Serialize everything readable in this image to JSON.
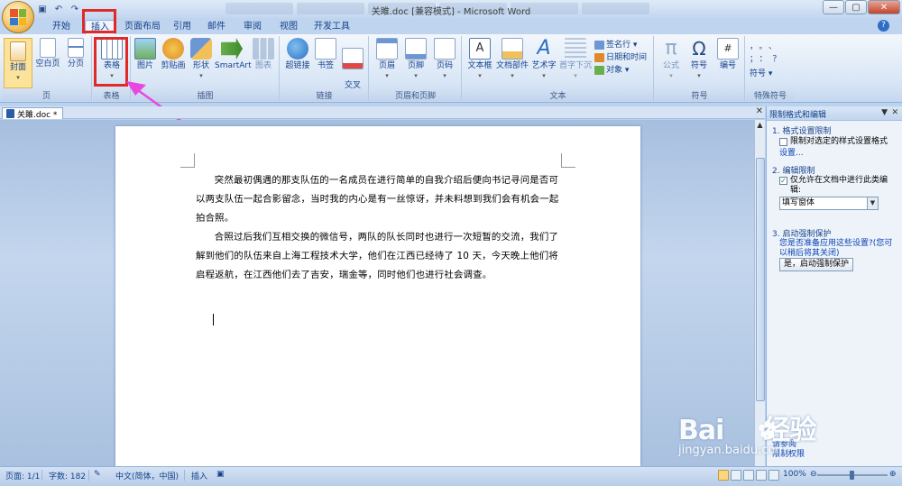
{
  "window": {
    "title": "关雎.doc [兼容模式] - Microsoft Word",
    "controls": [
      "—",
      "▢",
      "✕"
    ]
  },
  "quick_access": [
    "save-icon",
    "undo-icon",
    "redo-icon"
  ],
  "tabs": [
    "开始",
    "插入",
    "页面布局",
    "引用",
    "邮件",
    "审阅",
    "视图",
    "开发工具"
  ],
  "active_tab": "插入",
  "ribbon": {
    "groups": {
      "pages": {
        "label": "页",
        "buttons": [
          "封面",
          "空白页",
          "分页"
        ]
      },
      "tables": {
        "label": "表格",
        "buttons": [
          "表格"
        ]
      },
      "illustrations": {
        "label": "插图",
        "buttons": [
          "图片",
          "剪贴画",
          "形状",
          "SmartArt",
          "图表"
        ]
      },
      "links": {
        "label": "链接",
        "buttons": [
          "超链接",
          "书签",
          "交叉\n引用"
        ]
      },
      "header_footer": {
        "label": "页眉和页脚",
        "buttons": [
          "页眉",
          "页脚",
          "页码"
        ]
      },
      "text": {
        "label": "文本",
        "buttons": [
          "文本框",
          "文档部件",
          "艺术字",
          "首字下沉"
        ],
        "small": [
          "签名行 ▾",
          "日期和时间",
          "对象 ▾"
        ]
      },
      "symbols": {
        "label": "符号",
        "buttons": [
          "公式",
          "符号",
          "编号"
        ]
      },
      "special": {
        "label": "特殊符号",
        "chars": [
          "，",
          "。",
          "、",
          "；",
          "：",
          "？"
        ],
        "more": "符号 ▾"
      }
    }
  },
  "document": {
    "tab_name": "关雎.doc *",
    "paragraphs": [
      "突然最初偶遇的那支队伍的一名成员在进行简单的自我介绍后便向书记寻问是否可以两支队伍一起合影留念，当时我的内心是有一丝惊讶，并未料想到我们会有机会一起拍合照。",
      "合照过后我们互相交换的微信号，两队的队长同时也进行一次短暂的交流，我们了解到他们的队伍来自上海工程技术大学，他们在江西已经待了 10 天，今天晚上他们将启程返航，在江西他们去了吉安，瑞金等，同时他们也进行社会调查。"
    ]
  },
  "task_pane": {
    "title": "限制格式和编辑",
    "section1": {
      "heading": "1. 格式设置限制",
      "checkbox_label": "限制对选定的样式设置格式",
      "link": "设置..."
    },
    "section2": {
      "heading": "2. 编辑限制",
      "checkbox_label": "仅允许在文档中进行此类编辑:",
      "select_value": "填写窗体"
    },
    "section3": {
      "heading": "3. 启动强制保护",
      "question": "您是否准备应用这些设置?(您可以稍后将其关闭)",
      "button": "是，启动强制保护"
    },
    "bottom_links": [
      "请参阅",
      "限制权限"
    ]
  },
  "watermark": {
    "logo": "Bai",
    "logo_suffix": "经验",
    "url": "jingyan.baidu.com"
  },
  "status_bar": {
    "page": "页面: 1/1",
    "words": "字数: 182",
    "language": "中文(简体，中国)",
    "mode": "插入",
    "zoom": "100%"
  },
  "colors": {
    "highlight": "#e02a2a",
    "arrow": "#e848e0",
    "ribbon_bg": "#d9e6f6",
    "accent": "#15428b"
  }
}
